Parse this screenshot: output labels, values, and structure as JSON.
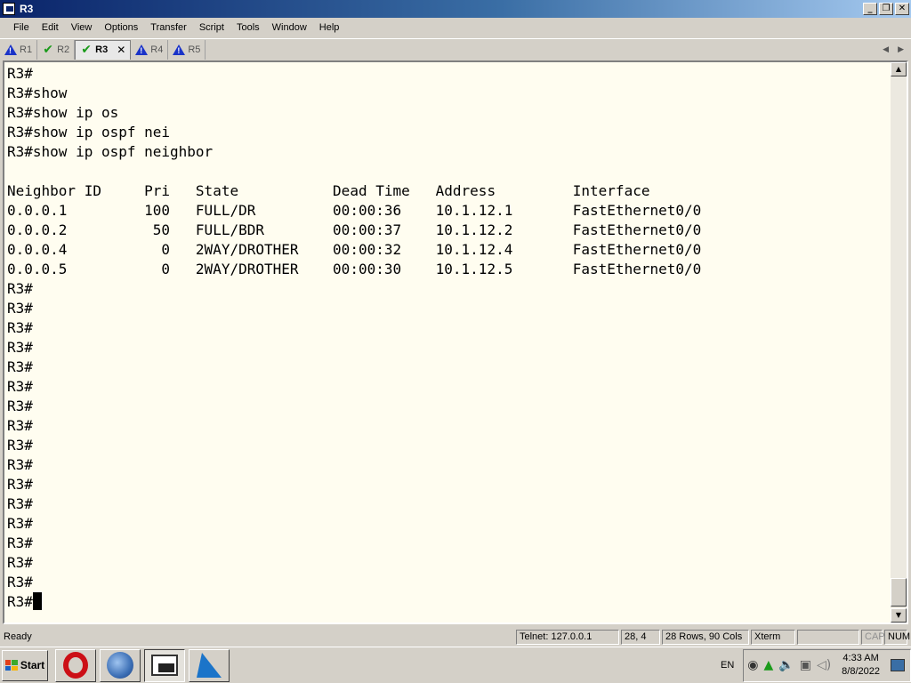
{
  "window": {
    "title": "R3"
  },
  "menu": [
    "File",
    "Edit",
    "View",
    "Options",
    "Transfer",
    "Script",
    "Tools",
    "Window",
    "Help"
  ],
  "tabs": [
    {
      "label": "R1",
      "icon": "warning-icon"
    },
    {
      "label": "R2",
      "icon": "check-icon"
    },
    {
      "label": "R3",
      "icon": "check-icon",
      "active": true
    },
    {
      "label": "R4",
      "icon": "warning-icon"
    },
    {
      "label": "R5",
      "icon": "warning-icon"
    }
  ],
  "terminal": {
    "lines": [
      "R3#",
      "R3#show",
      "R3#show ip os",
      "R3#show ip ospf nei",
      "R3#show ip ospf neighbor",
      "",
      "Neighbor ID     Pri   State           Dead Time   Address         Interface",
      "0.0.0.1         100   FULL/DR         00:00:36    10.1.12.1       FastEthernet0/0",
      "0.0.0.2          50   FULL/BDR        00:00:37    10.1.12.2       FastEthernet0/0",
      "0.0.0.4           0   2WAY/DROTHER    00:00:32    10.1.12.4       FastEthernet0/0",
      "0.0.0.5           0   2WAY/DROTHER    00:00:30    10.1.12.5       FastEthernet0/0",
      "R3#",
      "R3#",
      "R3#",
      "R3#",
      "R3#",
      "R3#",
      "R3#",
      "R3#",
      "R3#",
      "R3#",
      "R3#",
      "R3#",
      "R3#",
      "R3#",
      "R3#",
      "R3#"
    ],
    "prompt": "R3#"
  },
  "status": {
    "ready": "Ready",
    "connection": "Telnet: 127.0.0.1",
    "position": "28,  4",
    "size": "28 Rows, 90 Cols",
    "emulation": "Xterm",
    "cap": "CAP",
    "num": "NUM"
  },
  "taskbar": {
    "start": "Start",
    "lang": "EN",
    "time": "4:33 AM",
    "date": "8/8/2022"
  }
}
